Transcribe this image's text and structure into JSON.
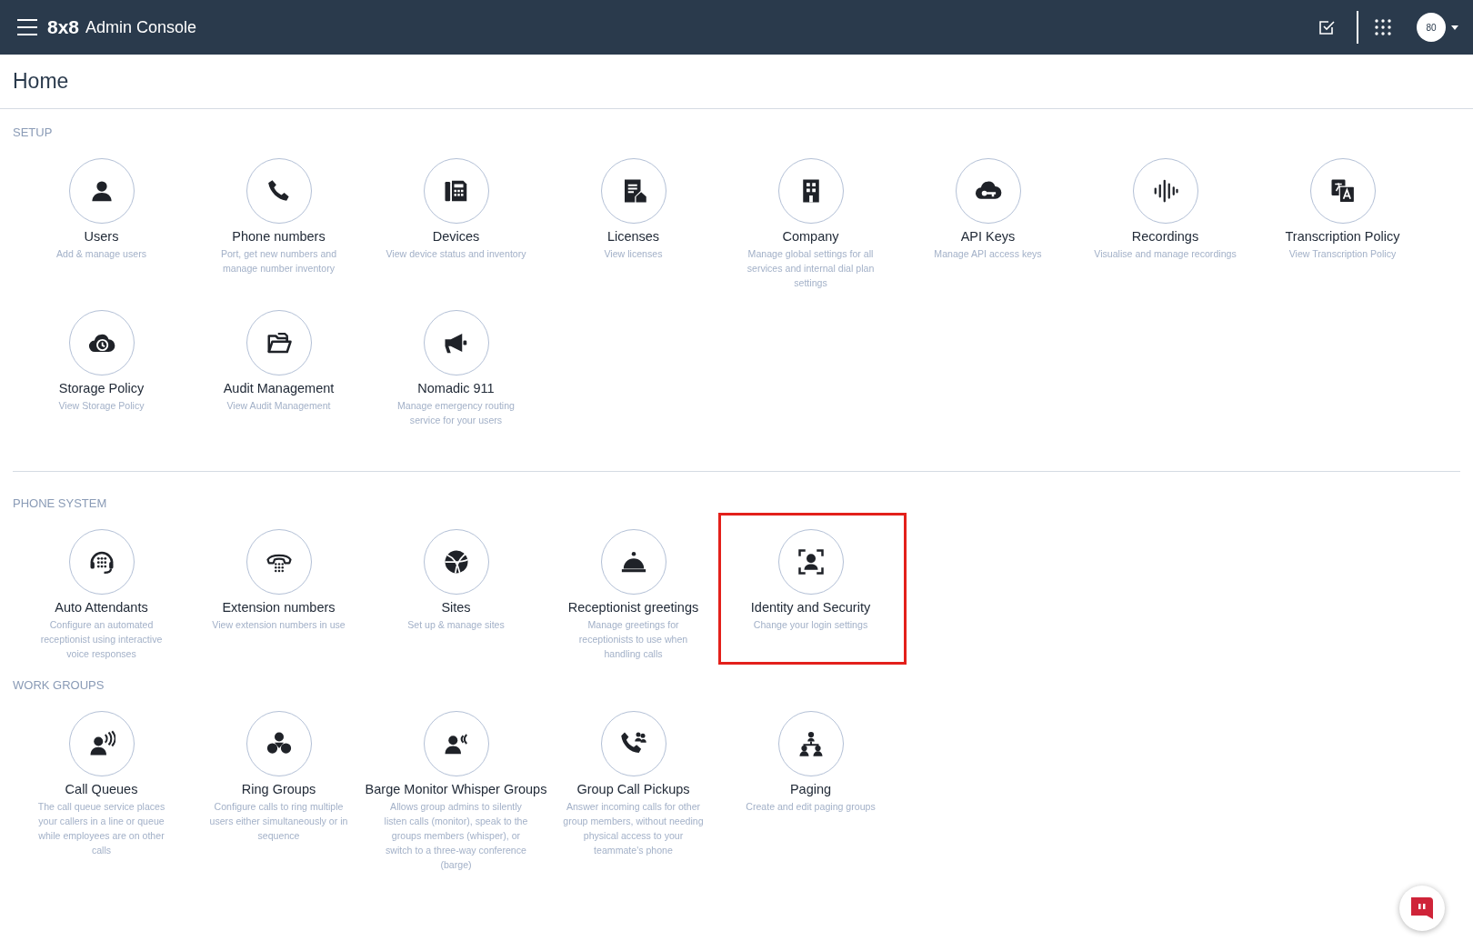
{
  "app": {
    "logo": "8x8",
    "title": "Admin Console",
    "avatar": "80"
  },
  "page_title": "Home",
  "sections": [
    {
      "title": "SETUP",
      "items": [
        {
          "title": "Users",
          "description": "Add & manage users",
          "highlighted": false
        },
        {
          "title": "Phone numbers",
          "description": "Port, get new numbers and manage number inventory",
          "highlighted": false
        },
        {
          "title": "Devices",
          "description": "View device status and inventory",
          "highlighted": false
        },
        {
          "title": "Licenses",
          "description": "View licenses",
          "highlighted": false
        },
        {
          "title": "Company",
          "description": "Manage global settings for all services and internal dial plan settings",
          "highlighted": false
        },
        {
          "title": "API Keys",
          "description": "Manage API access keys",
          "highlighted": false
        },
        {
          "title": "Recordings",
          "description": "Visualise and manage recordings",
          "highlighted": false
        },
        {
          "title": "Transcription Policy",
          "description": "View Transcription Policy",
          "highlighted": false
        },
        {
          "title": "Storage Policy",
          "description": "View Storage Policy",
          "highlighted": false
        },
        {
          "title": "Audit Management",
          "description": "View Audit Management",
          "highlighted": false
        },
        {
          "title": "Nomadic 911",
          "description": "Manage emergency routing service for your users",
          "highlighted": false
        }
      ]
    },
    {
      "title": "PHONE SYSTEM",
      "items": [
        {
          "title": "Auto Attendants",
          "description": "Configure an automated receptionist using interactive voice responses",
          "highlighted": false
        },
        {
          "title": "Extension numbers",
          "description": "View extension numbers in use",
          "highlighted": false
        },
        {
          "title": "Sites",
          "description": "Set up & manage sites",
          "highlighted": false
        },
        {
          "title": "Receptionist greetings",
          "description": "Manage greetings for receptionists to use when handling calls",
          "highlighted": false
        },
        {
          "title": "Identity and Security",
          "description": "Change your login settings",
          "highlighted": true
        }
      ]
    },
    {
      "title": "WORK GROUPS",
      "items": [
        {
          "title": "Call Queues",
          "description": "The call queue service places your callers in a line or queue while employees are on other calls",
          "highlighted": false
        },
        {
          "title": "Ring Groups",
          "description": "Configure calls to ring multiple users either simultaneously or in sequence",
          "highlighted": false
        },
        {
          "title": "Barge Monitor Whisper Groups",
          "description": "Allows group admins to silently listen calls (monitor), speak to the groups members (whisper), or switch to a three-way conference (barge)",
          "highlighted": false
        },
        {
          "title": "Group Call Pickups",
          "description": "Answer incoming calls for other group members, without needing physical access to your teammate's phone",
          "highlighted": false
        },
        {
          "title": "Paging",
          "description": "Create and edit paging groups",
          "highlighted": false
        }
      ]
    }
  ]
}
